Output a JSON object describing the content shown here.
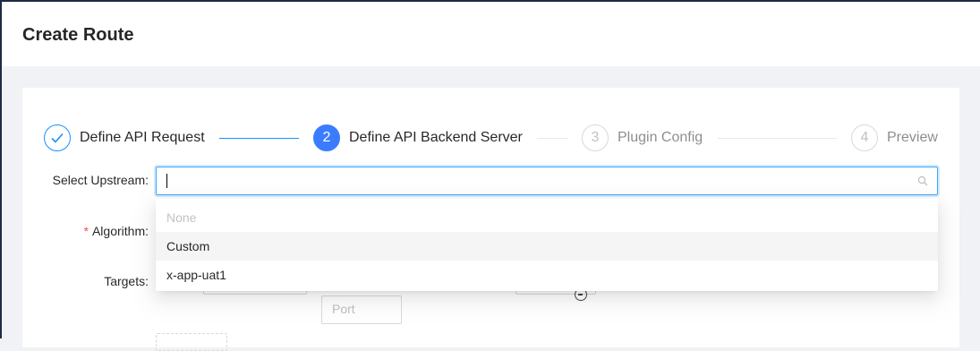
{
  "header": {
    "title": "Create Route"
  },
  "steps": [
    {
      "index": "1",
      "title": "Define API Request",
      "status": "done"
    },
    {
      "index": "2",
      "title": "Define API Backend Server",
      "status": "active"
    },
    {
      "index": "3",
      "title": "Plugin Config",
      "status": "wait"
    },
    {
      "index": "4",
      "title": "Preview",
      "status": "wait"
    }
  ],
  "colors": {
    "primary": "#1890ff",
    "active_step": "#3b7cff",
    "required": "#ff4d4f"
  },
  "form": {
    "select_upstream_label": "Select Upstream",
    "algorithm_label": "Algorithm",
    "targets_label": "Targets",
    "upstream_value": "",
    "port_placeholder": "Port"
  },
  "dropdown": {
    "options": [
      {
        "label": "None",
        "disabled": true
      },
      {
        "label": "Custom",
        "hover": true
      },
      {
        "label": "x-app-uat1"
      }
    ]
  }
}
